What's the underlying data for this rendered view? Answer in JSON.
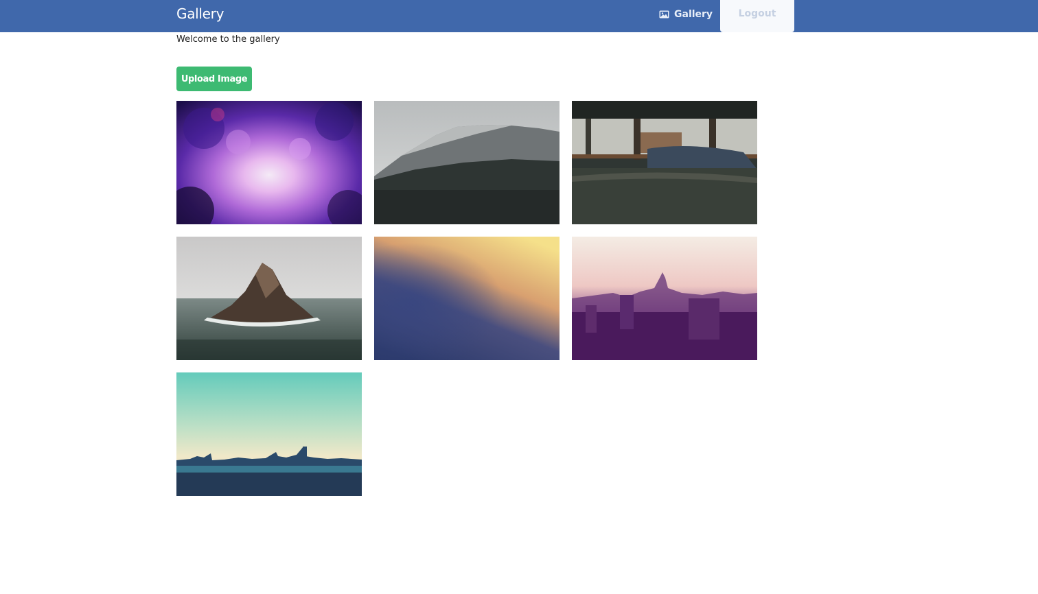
{
  "navbar": {
    "brand": "Gallery",
    "gallery_link": "Gallery",
    "gallery_icon": "image-icon",
    "logout_link": "Logout",
    "colors": {
      "bar": "#4068ab"
    }
  },
  "main": {
    "welcome_text": "Welcome to the gallery",
    "upload_button": "Upload Image",
    "upload_color": "#3dba72"
  },
  "gallery": {
    "images": [
      {
        "subject": "abstract purple painting"
      },
      {
        "subject": "misty mountain forest"
      },
      {
        "subject": "bed by window"
      },
      {
        "subject": "rock island in sea"
      },
      {
        "subject": "blurred gradient"
      },
      {
        "subject": "purple city skyline"
      },
      {
        "subject": "teal city skyline"
      }
    ]
  }
}
